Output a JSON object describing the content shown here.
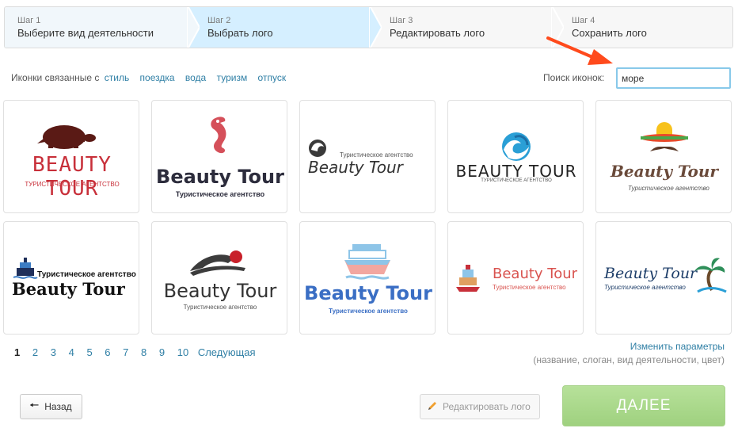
{
  "steps": [
    {
      "num": "Шаг 1",
      "title": "Выберите вид деятельности"
    },
    {
      "num": "Шаг 2",
      "title": "Выбрать лого"
    },
    {
      "num": "Шаг 3",
      "title": "Редактировать лого"
    },
    {
      "num": "Шаг 4",
      "title": "Сохранить лого"
    }
  ],
  "filters": {
    "related_label": "Иконки связанные с",
    "tags": [
      "стиль",
      "поездка",
      "вода",
      "туризм",
      "отпуск"
    ],
    "search_label": "Поиск иконок:",
    "search_value": "море"
  },
  "logos": [
    {
      "name": "BEAUTY TOUR",
      "tagline": "ТУРИСТИЧЕСКОЕ АГЕНТСТВО",
      "icon": "turtle-icon"
    },
    {
      "name": "Beauty Tour",
      "tagline": "Туристическое агентство",
      "icon": "seahorse-icon"
    },
    {
      "name": "Beauty Tour",
      "tagline": "Туристическое агентство",
      "icon": "wave-icon"
    },
    {
      "name": "BEAUTY TOUR",
      "tagline": "ТУРИСТИЧЕСКОЕ АГЕНТСТВО",
      "icon": "wave-circle-icon"
    },
    {
      "name": "Beauty Tour",
      "tagline": "Туристическое агентство",
      "icon": "sombrero-icon"
    },
    {
      "name": "Beauty Tour",
      "tagline": "Туристическое агентство",
      "icon": "ship-icon"
    },
    {
      "name": "Beauty Tour",
      "tagline": "Туристическое агентство",
      "icon": "swimmer-icon"
    },
    {
      "name": "Beauty Tour",
      "tagline": "Туристическое агентство",
      "icon": "cruise-ship-icon"
    },
    {
      "name": "Beauty Tour",
      "tagline": "Туристическое агентство",
      "icon": "boat-icon"
    },
    {
      "name": "Beauty Tour",
      "tagline": "Туристическое агентство",
      "icon": "palm-icon"
    }
  ],
  "pagination": {
    "pages": [
      "1",
      "2",
      "3",
      "4",
      "5",
      "6",
      "7",
      "8",
      "9",
      "10"
    ],
    "current": "1",
    "next_label": "Следующая"
  },
  "params": {
    "change_label": "Изменить параметры",
    "hint": "(название, слоган, вид деятельности, цвет)"
  },
  "buttons": {
    "back": "Назад",
    "edit": "Редактировать лого",
    "next": "ДАЛЕЕ"
  },
  "colors": {
    "link": "#2f7fa5",
    "step_active": "#d5efff",
    "next_button": "#a9d88a",
    "arrow_annotation": "#ff4a1c"
  }
}
